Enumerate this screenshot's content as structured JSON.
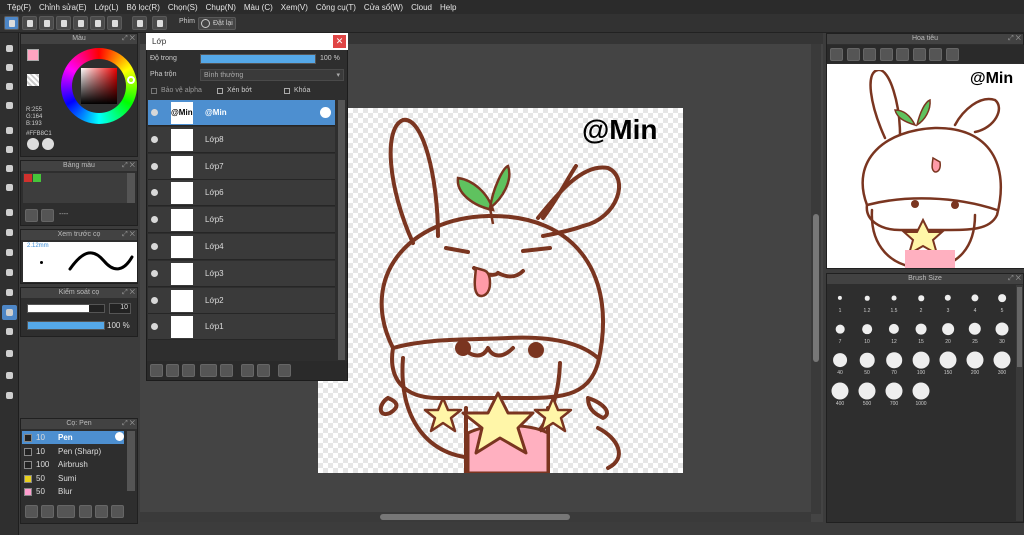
{
  "menu": [
    "Tệp(F)",
    "Chỉnh sửa(E)",
    "Lớp(L)",
    "Bộ lọc(R)",
    "Chọn(S)",
    "Chụp(N)",
    "Màu (C)",
    "Xem(V)",
    "Công cụ(T)",
    "Cửa sổ(W)",
    "Cloud",
    "Help"
  ],
  "toolbar": {
    "pin_label": "Phim",
    "no_label": "Đặt lại"
  },
  "color_panel": {
    "title": "Màu",
    "r": "R:255",
    "g": "G:164",
    "b": "B:193",
    "hex": "#FFB8C1",
    "fg": "#ffa4c1",
    "bg": "#ffffff"
  },
  "color_sets": {
    "title": "Bảng màu",
    "dash": "----",
    "swatches": [
      "#d0312d",
      "#46c53a"
    ]
  },
  "brush_preview": {
    "title": "Xem trước cọ",
    "size": "2.12mm"
  },
  "brush_control": {
    "title": "Kiểm soát cọ",
    "size_value": "10",
    "opacity_value": "100 %",
    "size_level": 0.8,
    "opacity_level": 1.0
  },
  "brush_list": {
    "title": "Cọ: Pen",
    "items": [
      {
        "size": "10",
        "name": "Pen",
        "color": "#222222"
      },
      {
        "size": "10",
        "name": "Pen (Sharp)",
        "color": "#222222"
      },
      {
        "size": "100",
        "name": "Airbrush",
        "color": "#222222"
      },
      {
        "size": "50",
        "name": "Sumi",
        "color": "#e8d01e"
      },
      {
        "size": "50",
        "name": "Blur",
        "color": "#ff9ecf"
      }
    ]
  },
  "layers": {
    "title": "Lớp",
    "opacity_label": "Độ trong",
    "opacity_value": "100 %",
    "opacity_level": 1.0,
    "blend_label": "Pha trộn",
    "blend_value": "Bình thường",
    "protect_alpha": "Bảo vệ alpha",
    "clipping": "Xén bớt",
    "lock": "Khóa",
    "items": [
      {
        "name": "@Min",
        "thumb": "@Min"
      },
      {
        "name": "Lớp8"
      },
      {
        "name": "Lớp7"
      },
      {
        "name": "Lớp6"
      },
      {
        "name": "Lớp5"
      },
      {
        "name": "Lớp4"
      },
      {
        "name": "Lớp3"
      },
      {
        "name": "Lớp2"
      },
      {
        "name": "Lớp1"
      }
    ]
  },
  "canvas_text": "@Min",
  "navigator": {
    "title": "Hoa tiêu",
    "text": "@Min"
  },
  "brush_size": {
    "title": "Brush Size",
    "sizes": [
      "1",
      "1.2",
      "1.5",
      "2",
      "3",
      "4",
      "5",
      "7",
      "10",
      "12",
      "15",
      "20",
      "25",
      "30",
      "40",
      "50",
      "70",
      "100",
      "150",
      "200",
      "300",
      "400",
      "500",
      "700",
      "1000"
    ]
  },
  "accent": "#4d8fd0"
}
